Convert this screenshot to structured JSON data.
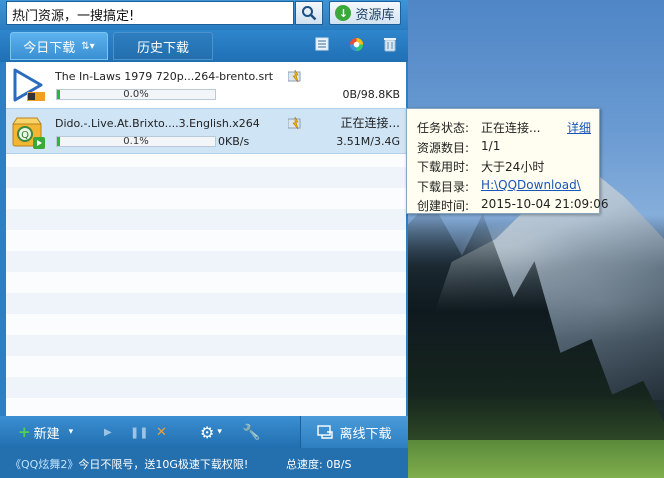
{
  "search": {
    "value": "热门资源，一搜搞定!",
    "resource_button": "资源库"
  },
  "tabs": [
    {
      "label": "今日下载",
      "sort_glyph": "⇅▾"
    },
    {
      "label": "历史下载"
    }
  ],
  "downloads": [
    {
      "name": "The In-Laws 1979 720p...264-brento.srt",
      "progress_text": "0.0%",
      "progress": 0.0,
      "size": "0B/98.8KB",
      "status": ""
    },
    {
      "name": "Dido.-.Live.At.Brixto....3.English.x264",
      "progress_text": "0.1%",
      "progress": 0.001,
      "speed": "0KB/s",
      "size": "3.51M/3.4G",
      "status": "正在连接..."
    }
  ],
  "tooltip": {
    "detail_link": "详细",
    "rows": [
      {
        "label": "任务状态:",
        "value": "正在连接..."
      },
      {
        "label": "资源数目:",
        "value": "1/1"
      },
      {
        "label": "下载用时:",
        "value": "大于24小时"
      },
      {
        "label": "下载目录:",
        "value": "H:\\QQDownload\\"
      },
      {
        "label": "创建时间:",
        "value": "2015-10-04 21:09:06"
      }
    ]
  },
  "toolbar": {
    "new_label": "新建",
    "offline_label": "离线下载"
  },
  "statusbar": {
    "promo_game": "《QQ炫舞2》",
    "promo_text": "今日不限号，送10G极速下载权限!",
    "total_speed": "总速度: 0B/S"
  },
  "colors": {
    "accent": "#2b7fc4",
    "progress": "#2ab83a",
    "link": "#1a56b8"
  }
}
